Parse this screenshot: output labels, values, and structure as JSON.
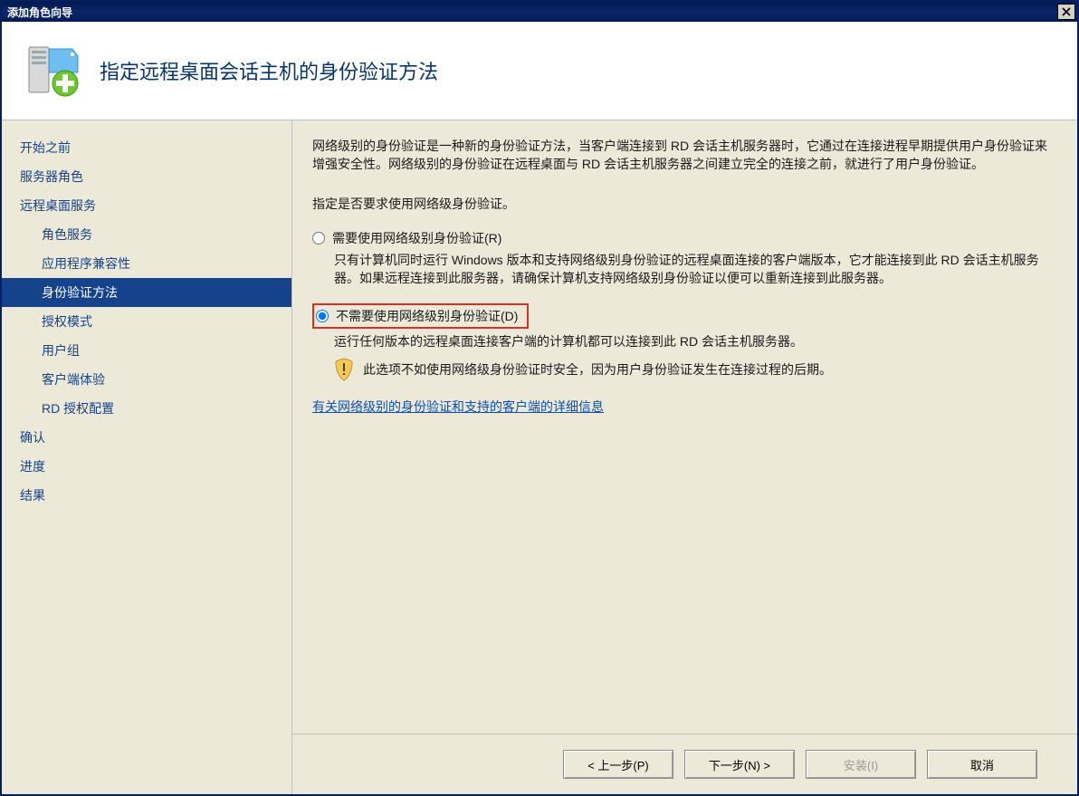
{
  "window": {
    "title": "添加角色向导"
  },
  "header": {
    "title": "指定远程桌面会话主机的身份验证方法"
  },
  "sidebar": {
    "items": [
      {
        "label": "开始之前",
        "sub": false,
        "active": false
      },
      {
        "label": "服务器角色",
        "sub": false,
        "active": false
      },
      {
        "label": "远程桌面服务",
        "sub": false,
        "active": false
      },
      {
        "label": "角色服务",
        "sub": true,
        "active": false
      },
      {
        "label": "应用程序兼容性",
        "sub": true,
        "active": false
      },
      {
        "label": "身份验证方法",
        "sub": true,
        "active": true
      },
      {
        "label": "授权模式",
        "sub": true,
        "active": false
      },
      {
        "label": "用户组",
        "sub": true,
        "active": false
      },
      {
        "label": "客户端体验",
        "sub": true,
        "active": false
      },
      {
        "label": "RD 授权配置",
        "sub": true,
        "active": false
      },
      {
        "label": "确认",
        "sub": false,
        "active": false
      },
      {
        "label": "进度",
        "sub": false,
        "active": false
      },
      {
        "label": "结果",
        "sub": false,
        "active": false
      }
    ]
  },
  "content": {
    "intro": "网络级别的身份验证是一种新的身份验证方法，当客户端连接到 RD 会话主机服务器时，它通过在连接进程早期提供用户身份验证来增强安全性。网络级别的身份验证在远程桌面与 RD 会话主机服务器之间建立完全的连接之前，就进行了用户身份验证。",
    "prompt": "指定是否要求使用网络级身份验证。",
    "option1": {
      "label": "需要使用网络级别身份验证(R)",
      "desc": "只有计算机同时运行 Windows 版本和支持网络级别身份验证的远程桌面连接的客户端版本，它才能连接到此 RD 会话主机服务器。如果远程连接到此服务器，请确保计算机支持网络级别身份验证以便可以重新连接到此服务器。"
    },
    "option2": {
      "label": "不需要使用网络级别身份验证(D)",
      "desc": "运行任何版本的远程桌面连接客户端的计算机都可以连接到此 RD 会话主机服务器。",
      "warning": "此选项不如使用网络级身份验证时安全，因为用户身份验证发生在连接过程的后期。"
    },
    "link": "有关网络级别的身份验证和支持的客户端的详细信息"
  },
  "footer": {
    "prev": "< 上一步(P)",
    "next": "下一步(N) >",
    "install": "安装(I)",
    "cancel": "取消"
  }
}
